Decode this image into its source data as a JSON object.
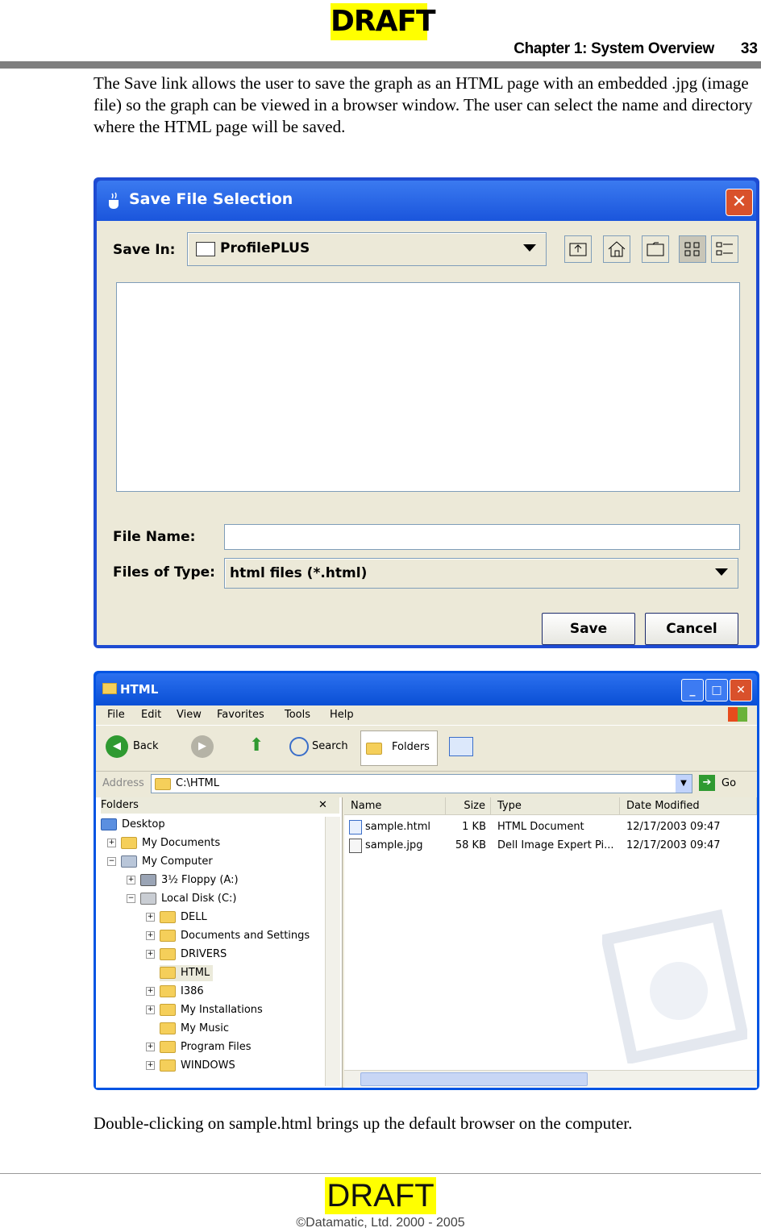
{
  "page": {
    "draft_top": "DRAFT",
    "header": "Chapter 1:  System Overview",
    "page_number": "33",
    "paragraph": "The Save link allows the user to save the graph as an HTML page with an embedded .jpg (image file) so the graph can be viewed in a browser window.  The user can select the name and directory where the HTML page will be saved.",
    "caption": "Double-clicking on sample.html brings up the default browser on the computer.",
    "draft_bottom": "DRAFT",
    "copyright": "©Datamatic, Ltd. 2000 - 2005"
  },
  "save_dialog": {
    "title": "Save File Selection",
    "close": "✕",
    "save_in_label": "Save In:",
    "save_in_value": "ProfilePLUS",
    "file_name_label": "File Name:",
    "file_name_value": "",
    "files_of_type_label": "Files of Type:",
    "files_of_type_value": "html files (*.html)",
    "save_button": "Save",
    "cancel_button": "Cancel"
  },
  "explorer": {
    "title": "HTML",
    "menu": [
      "File",
      "Edit",
      "View",
      "Favorites",
      "Tools",
      "Help"
    ],
    "toolbar": {
      "back": "Back",
      "search": "Search",
      "folders": "Folders"
    },
    "address_label": "Address",
    "address_value": "C:\\HTML",
    "go": "Go",
    "folders_pane_title": "Folders",
    "tree": [
      {
        "label": "Desktop"
      },
      {
        "label": "My Documents"
      },
      {
        "label": "My Computer"
      },
      {
        "label": "3½ Floppy (A:)"
      },
      {
        "label": "Local Disk (C:)"
      },
      {
        "label": "DELL"
      },
      {
        "label": "Documents and Settings"
      },
      {
        "label": "DRIVERS"
      },
      {
        "label": "HTML"
      },
      {
        "label": "I386"
      },
      {
        "label": "My Installations"
      },
      {
        "label": "My Music"
      },
      {
        "label": "Program Files"
      },
      {
        "label": "WINDOWS"
      }
    ],
    "columns": [
      "Name",
      "Size",
      "Type",
      "Date Modified"
    ],
    "files": [
      {
        "name": "sample.html",
        "size": "1 KB",
        "type": "HTML Document",
        "modified": "12/17/2003 09:47"
      },
      {
        "name": "sample.jpg",
        "size": "58 KB",
        "type": "Dell Image Expert Pi...",
        "modified": "12/17/2003 09:47"
      }
    ]
  }
}
